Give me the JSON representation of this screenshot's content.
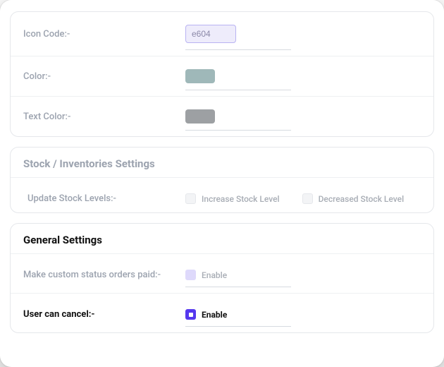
{
  "appearance": {
    "iconCode": {
      "label": "Icon Code:-",
      "value": "e604"
    },
    "color": {
      "label": "Color:-",
      "swatch": "#9fb8b9"
    },
    "textColor": {
      "label": "Text Color:-",
      "swatch": "#9da0a3"
    }
  },
  "stock": {
    "title": "Stock / Inventories Settings",
    "updateLevels": {
      "label": "Update Stock Levels:-",
      "increase": {
        "label": "Increase Stock Level",
        "checked": false
      },
      "decrease": {
        "label": "Decreased Stock Level",
        "checked": false
      }
    }
  },
  "general": {
    "title": "General Settings",
    "makePaid": {
      "label": "Make custom status orders paid:-",
      "option": "Enable",
      "state": "muted"
    },
    "userCancel": {
      "label": "User can cancel:-",
      "option": "Enable",
      "state": "on"
    }
  }
}
